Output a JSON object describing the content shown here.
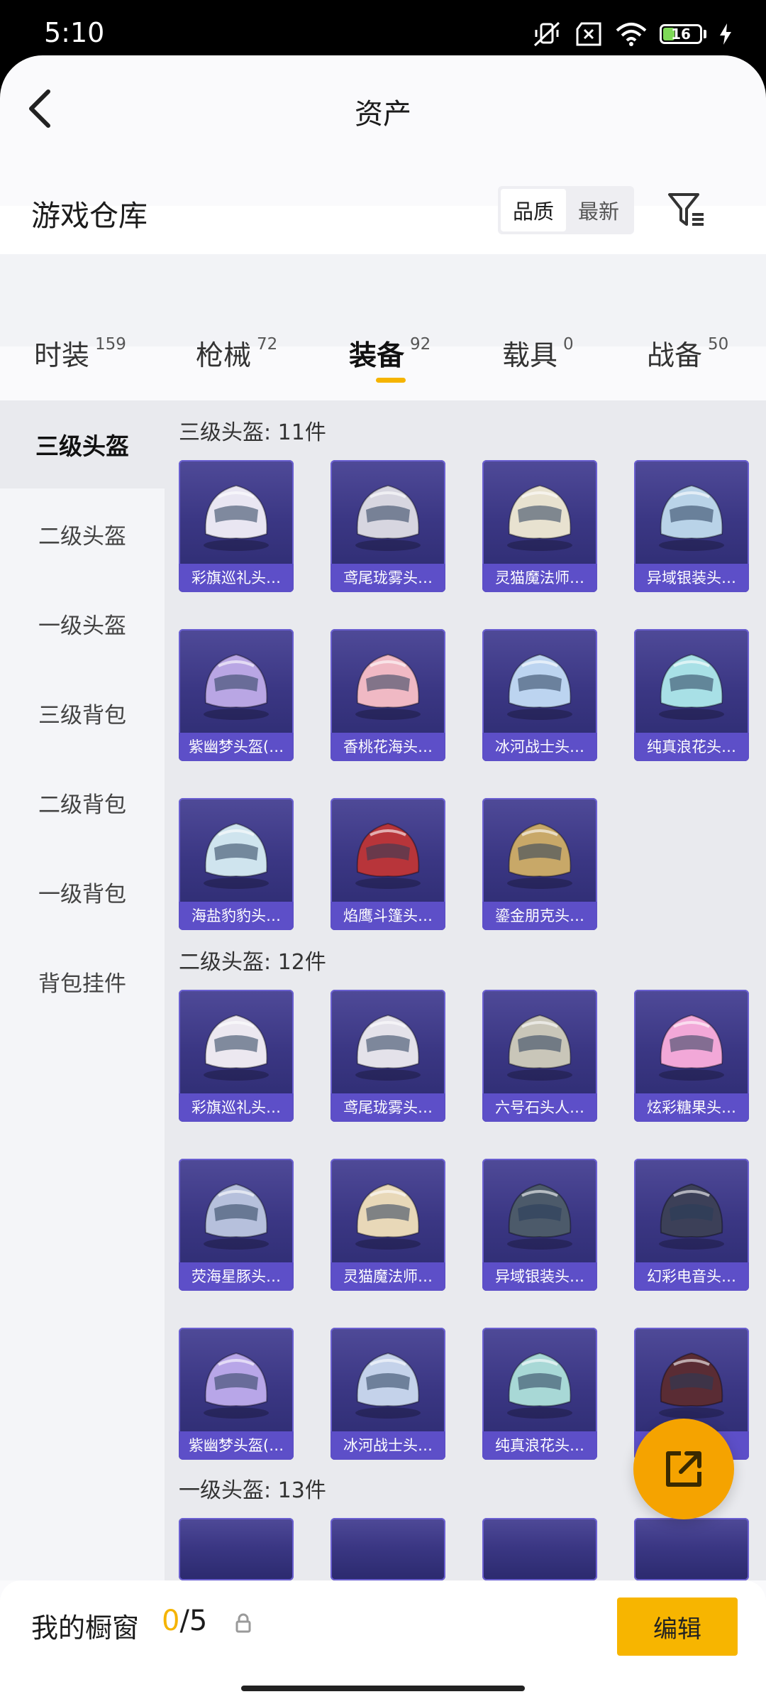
{
  "status": {
    "time": "5:10",
    "battery": "16"
  },
  "header": {
    "title": "资产"
  },
  "warehouse": {
    "title": "游戏仓库",
    "sort": [
      "品质",
      "最新"
    ]
  },
  "tabs": [
    {
      "label": "时装",
      "count": "159"
    },
    {
      "label": "枪械",
      "count": "72"
    },
    {
      "label": "装备",
      "count": "92"
    },
    {
      "label": "载具",
      "count": "0"
    },
    {
      "label": "战备",
      "count": "50"
    }
  ],
  "sidebar": [
    "三级头盔",
    "二级头盔",
    "一级头盔",
    "三级背包",
    "二级背包",
    "一级背包",
    "背包挂件"
  ],
  "sections": [
    {
      "title": "三级头盔: 11件",
      "items": [
        "彩旗巡礼头…",
        "鸢尾珑雾头…",
        "灵猫魔法师…",
        "异域银装头…",
        "紫幽梦头盔(…",
        "香桃花海头…",
        "冰河战士头…",
        "纯真浪花头…",
        "海盐豹豹头…",
        "焰鹰斗篷头…",
        "鎏金朋克头…"
      ]
    },
    {
      "title": "二级头盔: 12件",
      "items": [
        "彩旗巡礼头…",
        "鸢尾珑雾头…",
        "六号石头人…",
        "炫彩糖果头…",
        "荧海星豚头…",
        "灵猫魔法师…",
        "异域银装头…",
        "幻彩电音头…",
        "紫幽梦头盔(…",
        "冰河战士头…",
        "纯真浪花头…",
        "…"
      ]
    },
    {
      "title": "一级头盔: 13件",
      "items": []
    }
  ],
  "showcase": {
    "label": "我的橱窗",
    "current": "0",
    "total": "/5",
    "edit": "编辑"
  }
}
